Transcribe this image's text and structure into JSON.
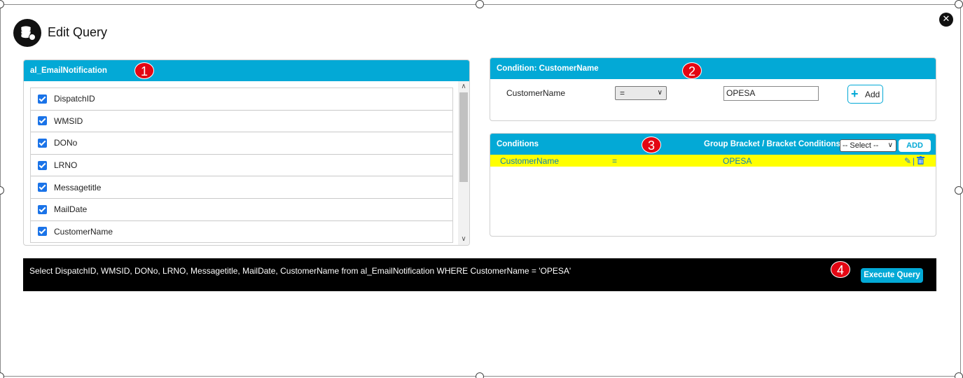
{
  "window": {
    "title": "Edit Query",
    "close_icon": "close-circle-icon",
    "header_icon": "database-icon"
  },
  "badges": [
    "1",
    "2",
    "3",
    "4"
  ],
  "table_panel": {
    "title": "al_EmailNotification",
    "fields": [
      {
        "label": "DispatchID",
        "checked": true
      },
      {
        "label": "WMSID",
        "checked": true
      },
      {
        "label": "DONo",
        "checked": true
      },
      {
        "label": "LRNO",
        "checked": true
      },
      {
        "label": "Messagetitle",
        "checked": true
      },
      {
        "label": "MailDate",
        "checked": true
      },
      {
        "label": "CustomerName",
        "checked": true
      }
    ]
  },
  "condition_panel": {
    "title": "Condition: CustomerName",
    "field_label": "CustomerName",
    "operator": "=",
    "value": "OPESA",
    "add_label": "Add"
  },
  "conditions_panel": {
    "title": "Conditions",
    "group_label": "Group Bracket / Bracket Conditions:",
    "group_select": "-- Select --",
    "add_label": "ADD",
    "rows": [
      {
        "field": "CustomerName",
        "operator": "=",
        "value": "OPESA"
      }
    ]
  },
  "query": {
    "sql": "Select DispatchID, WMSID, DONo, LRNO, Messagetitle, MailDate, CustomerName from al_EmailNotification WHERE CustomerName = 'OPESA'",
    "execute_label": "Execute Query"
  },
  "colors": {
    "accent": "#03a9d6",
    "highlight": "#ffff00",
    "badge": "#e30613"
  }
}
